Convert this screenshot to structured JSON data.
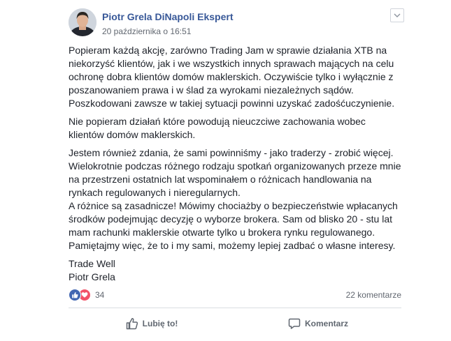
{
  "post": {
    "author": "Piotr Grela DiNapoli Ekspert",
    "timestamp": "20 października o 16:51",
    "menu_icon": "chevron-down-icon",
    "paragraphs": [
      "Popieram każdą akcję, zarówno Trading Jam w sprawie działania XTB na niekorzyść klientów, jak i we wszystkich innych sprawach mających na celu ochronę dobra klientów domów maklerskich. Oczywiście tylko i wyłącznie z poszanowaniem prawa i w ślad za wyrokami niezależnych sądów. Poszkodowani zawsze w takiej sytuacji powinni uzyskać zadośćuczynienie.",
      "Nie popieram działań które powodują nieuczciwe zachowania wobec klientów domów maklerskich.",
      "Jestem również zdania, że sami powinniśmy - jako traderzy - zrobić więcej. Wielokrotnie podczas różnego rodzaju spotkań organizowanych przeze mnie na przestrzeni ostatnich lat wspominałem o różnicach handlowania na rynkach regulowanych i nieregularnych.",
      "A różnice są zasadnicze! Mówimy chociażby o bezpieczeństwie wpłacanych środków podejmując decyzję o wyborze brokera. Sam od blisko 20 - stu lat mam rachunki maklerskie otwarte tylko u brokera rynku regulowanego. Pamiętajmy więc, że to i my sami, możemy lepiej zadbać o własne interesy."
    ],
    "signature_line1": "Trade Well",
    "signature_line2": "Piotr Grela"
  },
  "reactions": {
    "icons": [
      "like-reaction-icon",
      "love-reaction-icon"
    ],
    "count": "34",
    "comments": "22 komentarze"
  },
  "actions": {
    "like_label": "Lubię to!",
    "comment_label": "Komentarz"
  },
  "colors": {
    "link": "#385898",
    "like_blue": "#4267b2",
    "love_red": "#f25268",
    "secondary_text": "#616770"
  }
}
